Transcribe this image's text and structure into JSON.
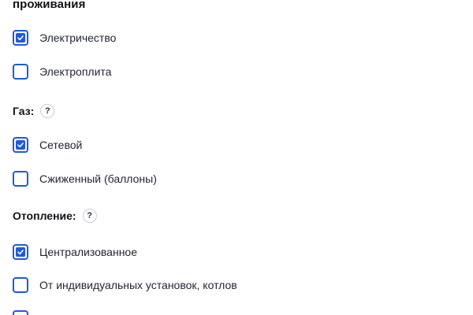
{
  "section": {
    "heading_tail": "проживания"
  },
  "electricity": {
    "options": [
      {
        "label": "Электричество",
        "checked": true
      },
      {
        "label": "Электроплита",
        "checked": false
      }
    ]
  },
  "gas": {
    "label": "Газ:",
    "help_glyph": "?",
    "options": [
      {
        "label": "Сетевой",
        "checked": true
      },
      {
        "label": "Сжиженный (баллоны)",
        "checked": false
      }
    ]
  },
  "heating": {
    "label": "Отопление:",
    "help_glyph": "?",
    "options": [
      {
        "label": "Централизованное",
        "checked": true
      },
      {
        "label": "От индивидуальных установок, котлов",
        "checked": false
      },
      {
        "label": "",
        "checked": false
      }
    ]
  },
  "colors": {
    "accent": "#1f5bd8"
  },
  "icons": {
    "help": "question-circle-icon",
    "checkmark": "checkmark-icon"
  }
}
